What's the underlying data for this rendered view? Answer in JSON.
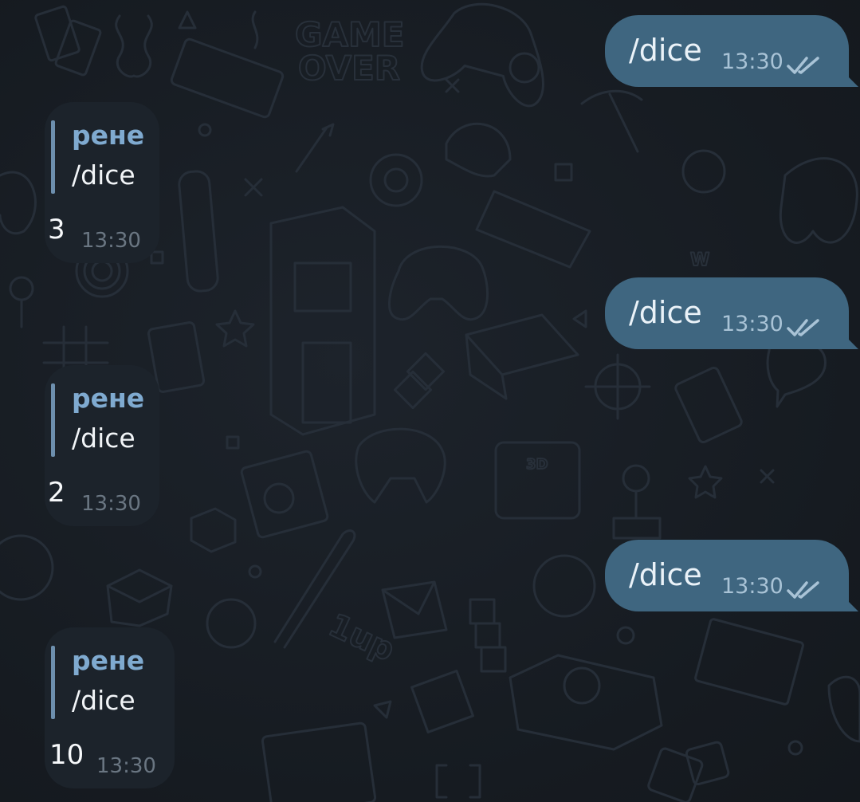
{
  "chat": {
    "outgoing": [
      {
        "text": "/dice",
        "time": "13:30",
        "status_icon": "double-check-icon"
      },
      {
        "text": "/dice",
        "time": "13:30",
        "status_icon": "double-check-icon"
      },
      {
        "text": "/dice",
        "time": "13:30",
        "status_icon": "double-check-icon"
      }
    ],
    "incoming": [
      {
        "reply_name": "рене",
        "reply_text": "/dice",
        "result": "3",
        "time": "13:30"
      },
      {
        "reply_name": "рене",
        "reply_text": "/dice",
        "result": "2",
        "time": "13:30"
      },
      {
        "reply_name": "рене",
        "reply_text": "/dice",
        "result": "10",
        "time": "13:30"
      }
    ]
  },
  "background": {
    "pattern_text": [
      "GAME",
      "OVER",
      "1up",
      "W",
      "3D"
    ]
  },
  "colors": {
    "outgoing_bubble": "#3f6680",
    "incoming_bubble": "#1c232b",
    "background": "#171d24",
    "reply_accent": "#6d8fae",
    "reply_name": "#7faad0",
    "time_outgoing": "#a9c3d6",
    "time_incoming": "#6a7682"
  }
}
